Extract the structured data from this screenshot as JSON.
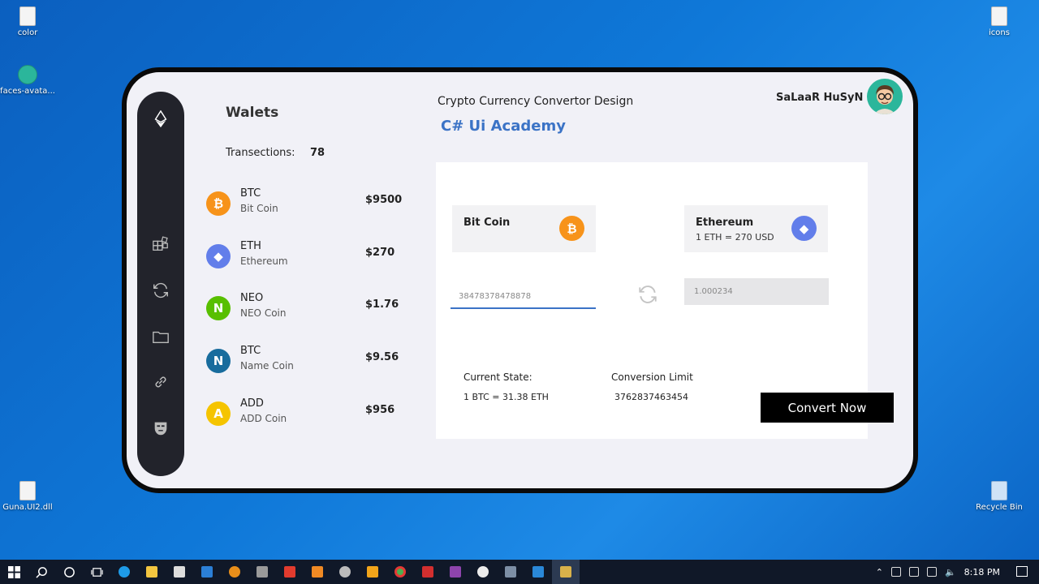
{
  "desktop": {
    "icons": [
      {
        "label": "color"
      },
      {
        "label": "faces-avata..."
      },
      {
        "label": "Guna.UI2.dll"
      },
      {
        "label": "icons"
      },
      {
        "label": "Recycle Bin"
      }
    ]
  },
  "sidebar": {
    "icons": [
      "ethereum-logo-icon",
      "grid-icon",
      "refresh-icon",
      "folder-icon",
      "link-icon",
      "mask-icon"
    ]
  },
  "wallets": {
    "title": "Walets",
    "transactions_label": "Transections:",
    "transactions_count": "78",
    "coins": [
      {
        "symbol": "BTC",
        "name": "Bit Coin",
        "price": "$9500",
        "color": "#f7931a",
        "glyph": "₿"
      },
      {
        "symbol": "ETH",
        "name": "Ethereum",
        "price": "$270",
        "color": "#627eea",
        "glyph": "◆"
      },
      {
        "symbol": "NEO",
        "name": "NEO Coin",
        "price": "$1.76",
        "color": "#58bf00",
        "glyph": "N"
      },
      {
        "symbol": "BTC",
        "name": "Name Coin",
        "price": "$9.56",
        "color": "#186c9d",
        "glyph": "N"
      },
      {
        "symbol": "ADD",
        "name": "ADD Coin",
        "price": "$956",
        "color": "#f5c400",
        "glyph": "A"
      }
    ]
  },
  "header": {
    "title": "Crypto Currency Convertor Design",
    "subtitle": "C# Ui Academy",
    "user_name": "SaLaaR HuSyN"
  },
  "converter": {
    "from_card": {
      "name": "Bit Coin",
      "color": "#f7931a",
      "glyph": "₿"
    },
    "to_card": {
      "name": "Ethereum",
      "rate": "1 ETH = 270 USD",
      "color": "#627eea",
      "glyph": "◆"
    },
    "from_value": "38478378478878",
    "to_value": "1.000234",
    "current_state_label": "Current State:",
    "current_state_value": "1 BTC = 31.38 ETH",
    "conversion_limit_label": "Conversion Limit",
    "conversion_limit_value": "3762837463454",
    "convert_label": "Convert Now"
  },
  "taskbar": {
    "time": "8:18 PM"
  }
}
